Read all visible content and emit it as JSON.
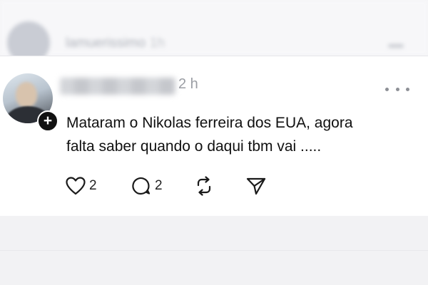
{
  "ghost_post": {
    "username": "lamuerissimo",
    "time": "1h"
  },
  "post": {
    "time": "2 h",
    "text_line1": "Mataram o Nikolas ferreira dos EUA, agora",
    "text_line2": "falta saber quando o daqui tbm vai .....",
    "like_count": "2",
    "reply_count": "2"
  },
  "icons": {
    "follow": "plus-icon",
    "more": "ellipsis-icon",
    "like": "heart-icon",
    "reply": "comment-icon",
    "repost": "repost-icon",
    "share": "send-icon"
  },
  "colors": {
    "text": "#101010",
    "secondary": "#9b9ea4",
    "background": "#ffffff"
  }
}
